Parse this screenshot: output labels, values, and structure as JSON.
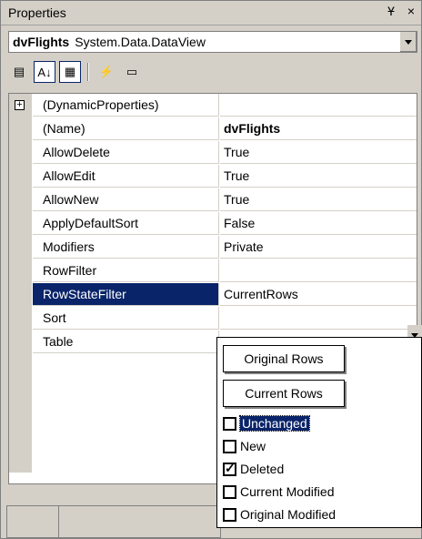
{
  "window": {
    "title": "Properties",
    "pin_glyph": "Ұ",
    "close_glyph": "×"
  },
  "object_selector": {
    "name": "dvFlights",
    "type": "System.Data.DataView"
  },
  "toolbar": {
    "buttons": [
      {
        "name": "categorized-icon",
        "glyph": "▤",
        "active": false
      },
      {
        "name": "alphabetical-icon",
        "glyph": "A↓",
        "active": true
      },
      {
        "name": "properties-icon",
        "glyph": "▦",
        "active": true
      },
      {
        "name": "events-icon",
        "glyph": "⚡",
        "active": false
      },
      {
        "name": "property-pages-icon",
        "glyph": "▭",
        "active": false
      }
    ]
  },
  "properties": [
    {
      "name": "(DynamicProperties)",
      "value": "",
      "expandable": true
    },
    {
      "name": "(Name)",
      "value": "dvFlights",
      "bold": true
    },
    {
      "name": "AllowDelete",
      "value": "True"
    },
    {
      "name": "AllowEdit",
      "value": "True"
    },
    {
      "name": "AllowNew",
      "value": "True"
    },
    {
      "name": "ApplyDefaultSort",
      "value": "False"
    },
    {
      "name": "Modifiers",
      "value": "Private"
    },
    {
      "name": "RowFilter",
      "value": ""
    },
    {
      "name": "RowStateFilter",
      "value": "CurrentRows",
      "selected": true
    },
    {
      "name": "Sort",
      "value": ""
    },
    {
      "name": "Table",
      "value": ""
    }
  ],
  "dropdown": {
    "buttons": [
      "Original Rows",
      "Current Rows"
    ],
    "options": [
      {
        "label": "Unchanged",
        "checked": false,
        "highlighted": true
      },
      {
        "label": "New",
        "checked": false
      },
      {
        "label": "Deleted",
        "checked": true
      },
      {
        "label": "Current Modified",
        "checked": false
      },
      {
        "label": "Original Modified",
        "checked": false
      }
    ]
  },
  "colors": {
    "selection": "#0a246a",
    "chrome": "#d4d0c8"
  }
}
